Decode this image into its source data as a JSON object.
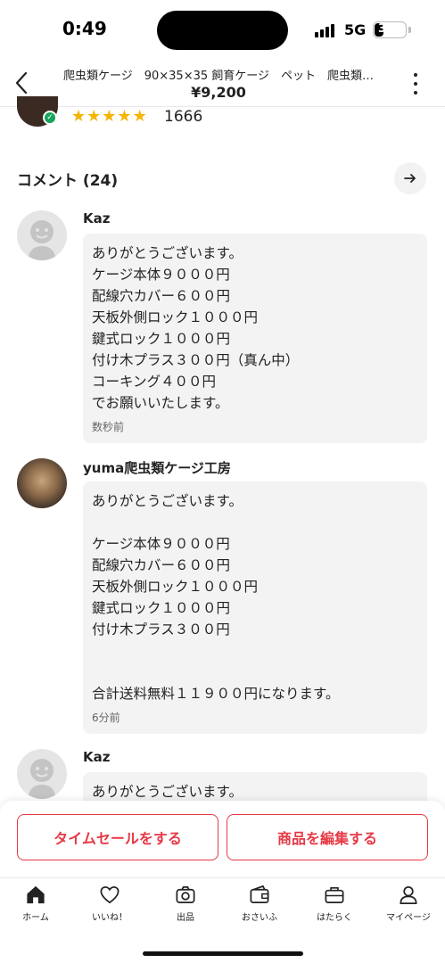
{
  "status_bar": {
    "time": "0:49",
    "network": "5G",
    "battery": "30",
    "battery_level": 0.3
  },
  "header": {
    "title": "爬虫類ケージ　90×35×35 飼育ケージ　ペット　爬虫類…",
    "price": "¥9,200",
    "back_icon": "chevron-left-icon",
    "more_icon": "vertical-dots-icon"
  },
  "seller": {
    "rating_stars": 5,
    "rating_count": "1666"
  },
  "comments_section": {
    "title": "コメント (24)"
  },
  "comments": [
    {
      "name": "Kaz",
      "lines": [
        "ありがとうございます。",
        "ケージ本体９０００円",
        "配線穴カバー６００円",
        "天板外側ロック１０００円",
        "鍵式ロック１０００円",
        "付け木プラス３００円（真ん中）",
        "コーキング４００円",
        "でお願いいたします。"
      ],
      "time": "数秒前"
    },
    {
      "name": "yuma爬虫類ケージ工房",
      "lines": [
        "ありがとうございます。",
        "",
        "ケージ本体９０００円",
        "配線穴カバー６００円",
        "天板外側ロック１０００円",
        "鍵式ロック１０００円",
        "付け木プラス３００円",
        "",
        "",
        "合計送料無料１１９００円になります。"
      ],
      "time": "6分前"
    },
    {
      "name": "Kaz",
      "lines": [
        "ありがとうございます。"
      ],
      "time": ""
    }
  ],
  "actions": {
    "time_sale": "タイムセールをする",
    "edit_item": "商品を編集する"
  },
  "tabs": [
    {
      "label": "ホーム",
      "icon": "home-icon"
    },
    {
      "label": "いいね！",
      "icon": "heart-icon"
    },
    {
      "label": "出品",
      "icon": "camera-icon"
    },
    {
      "label": "おさいふ",
      "icon": "wallet-icon"
    },
    {
      "label": "はたらく",
      "icon": "briefcase-icon"
    },
    {
      "label": "マイページ",
      "icon": "person-icon"
    }
  ],
  "colors": {
    "accent": "#e53946",
    "star": "#f5b400",
    "verified": "#18a35a"
  }
}
